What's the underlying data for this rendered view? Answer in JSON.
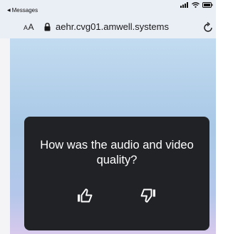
{
  "status_bar": {
    "back_label": "Messages"
  },
  "url_bar": {
    "text_size_label_small": "A",
    "text_size_label_large": "A",
    "url": "aehr.cvg01.amwell.systems"
  },
  "dialog": {
    "title": "How was the audio and video quality?"
  },
  "icons": {
    "back_caret": "back-caret-icon",
    "signal": "signal-icon",
    "wifi": "wifi-icon",
    "battery": "battery-icon",
    "lock": "lock-icon",
    "reload": "reload-icon",
    "thumbs_up": "thumbs-up-icon",
    "thumbs_down": "thumbs-down-icon"
  },
  "colors": {
    "dialog_background": "#202226",
    "browser_chrome": "#eaeef5"
  }
}
